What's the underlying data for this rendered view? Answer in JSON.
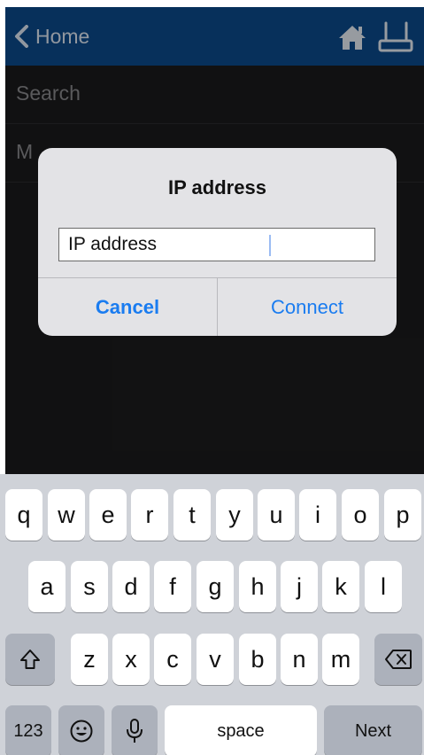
{
  "navbar": {
    "back_label": "Home",
    "icons": [
      "chevron-left-icon",
      "home-icon",
      "router-icon"
    ],
    "color": "#0b4a8c"
  },
  "list": {
    "search_placeholder": "Search",
    "row2_partial": "M"
  },
  "dialog": {
    "title": "IP address",
    "field_value": "IP address",
    "cancel_label": "Cancel",
    "connect_label": "Connect",
    "accent": "#1a7cf0"
  },
  "keyboard": {
    "row1": [
      "q",
      "w",
      "e",
      "r",
      "t",
      "y",
      "u",
      "i",
      "o",
      "p"
    ],
    "row2": [
      "a",
      "s",
      "d",
      "f",
      "g",
      "h",
      "j",
      "k",
      "l"
    ],
    "row3": [
      "z",
      "x",
      "c",
      "v",
      "b",
      "n",
      "m"
    ],
    "numbers_label": "123",
    "space_label": "space",
    "next_label": "Next",
    "icons": [
      "shift-icon",
      "backspace-icon",
      "emoji-icon",
      "microphone-icon"
    ]
  }
}
